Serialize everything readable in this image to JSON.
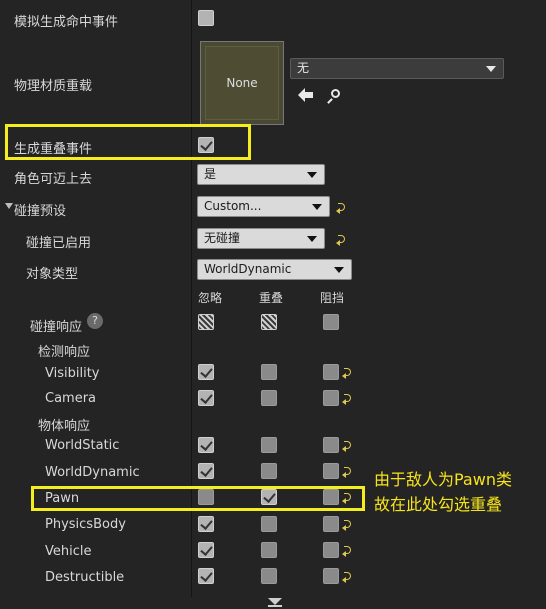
{
  "properties": {
    "simulate_hit_events": "模拟生成命中事件",
    "phys_material_override": "物理材质重载",
    "generate_overlap_events": "生成重叠事件",
    "can_character_step_up_on": "角色可迈上去",
    "collision_presets": "碰撞预设",
    "collision_enabled": "碰撞已启用",
    "object_type": "对象类型",
    "collision_responses": "碰撞响应",
    "trace_responses": "检测响应",
    "object_responses": "物体响应"
  },
  "material": {
    "thumbnail_label": "None",
    "selected": "无"
  },
  "combos": {
    "step_up": "是",
    "preset": "Custom...",
    "collision_enabled": "无碰撞",
    "object_type": "WorldDynamic"
  },
  "column_headers": [
    "忽略",
    "重叠",
    "阻挡"
  ],
  "rows": [
    "Visibility",
    "Camera",
    "WorldStatic",
    "WorldDynamic",
    "Pawn",
    "PhysicsBody",
    "Vehicle",
    "Destructible"
  ],
  "annotation": {
    "line1": "由于敌人为Pawn类",
    "line2": "故在此处勾选重叠"
  },
  "icons": {
    "help": "?",
    "browse": "arrow-left-icon",
    "search": "magnifier-icon",
    "reset": "reset-arrow-icon"
  },
  "colors": {
    "highlight": "#f4ee1f",
    "reset_arrow": "#e0c84a"
  }
}
